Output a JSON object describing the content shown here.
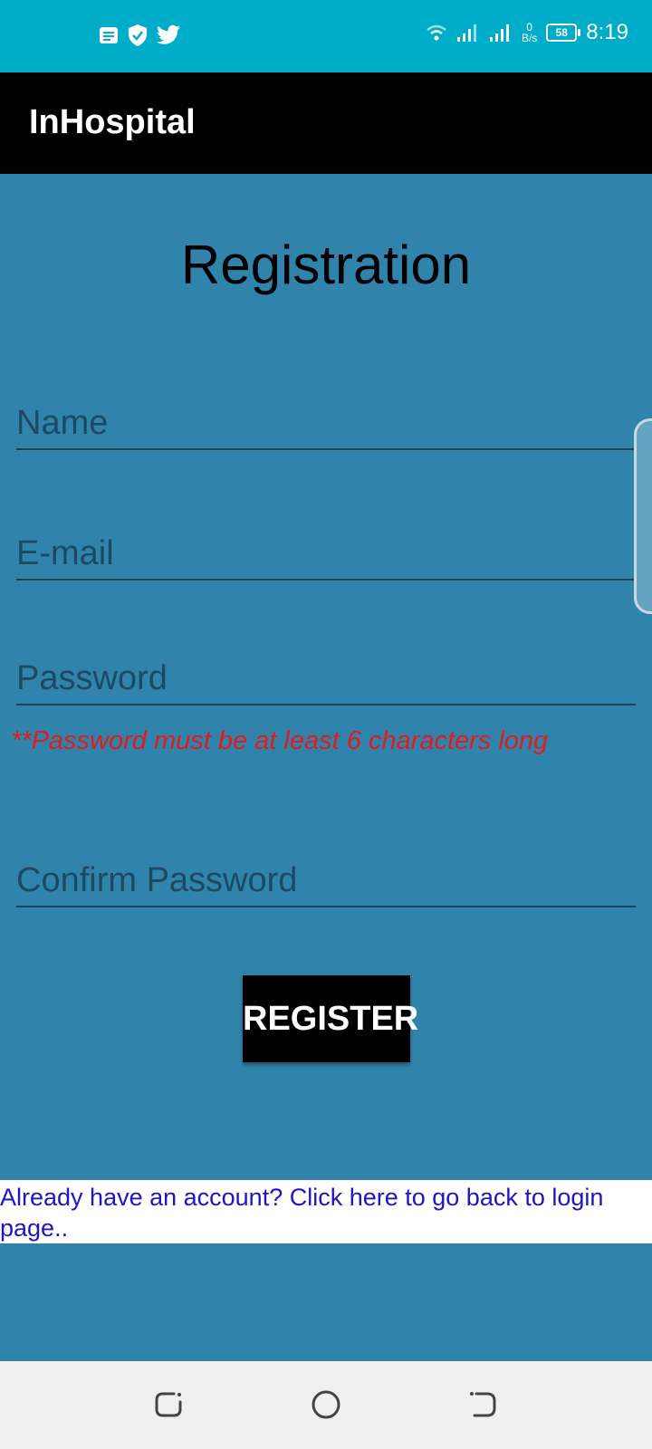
{
  "status_bar": {
    "time": "8:19",
    "battery": "58",
    "netspeed_value": "0",
    "netspeed_unit": "B/s",
    "left_icons": [
      "notification-icon",
      "shield-icon",
      "twitter-icon"
    ],
    "right_icons": [
      "wifi-icon",
      "signal-icon",
      "signal-icon",
      "battery-icon"
    ]
  },
  "app_bar": {
    "title": "InHospital"
  },
  "heading": "Registration",
  "form": {
    "name_placeholder": "Name",
    "email_placeholder": "E-mail",
    "password_placeholder": "Password",
    "password_hint": "**Password must be at least 6 characters long",
    "confirm_placeholder": "Confirm Password",
    "register_label": "REGISTER"
  },
  "login_link": "Already have an account? Click here to go back to login page..",
  "nav_bar": {
    "buttons": [
      "recent-apps-icon",
      "home-icon",
      "back-icon"
    ]
  },
  "colors": {
    "status_bar": "#00adc9",
    "app_bar": "#000000",
    "background": "#3084ac",
    "hint": "#e01b1b",
    "link": "#1f14c8"
  }
}
